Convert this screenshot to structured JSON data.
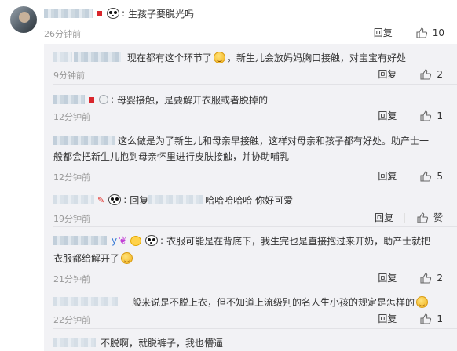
{
  "main_comment": {
    "text": "生孩子要脱光吗",
    "time": "26分钟前",
    "reply_label": "回复",
    "likes": "10"
  },
  "replies": [
    {
      "text_before_emoji": "现在都有这个环节了",
      "emoji": "laugh-cry-emoji",
      "text_after_emoji": "，新生儿会放妈妈胸口接触，对宝宝有好处",
      "time": "9分钟前",
      "reply_label": "回复",
      "likes": "2"
    },
    {
      "text": "母婴接触，是要解开衣服或者脱掉的",
      "time": "12分钟前",
      "reply_label": "回复",
      "likes": "1"
    },
    {
      "line1": "这么做是为了新生儿和母亲早接触，这样对母亲和孩子都有好处。助产士一",
      "line2": "般都会把新生儿抱到母亲怀里进行皮肤接触，并协助哺乳",
      "time": "12分钟前",
      "reply_label": "回复",
      "likes": "5"
    },
    {
      "prefix": "回复",
      "text": "哈哈哈哈哈 你好可爱",
      "time": "19分钟前",
      "reply_label": "回复",
      "likes": "赞"
    },
    {
      "name_suffix": "y",
      "line1": "衣服可能是在背底下，我生完也是直接抱过来开奶，助产士就把",
      "line2": "衣服都给解开了",
      "time": "21分钟前",
      "reply_label": "回复",
      "likes": "2"
    },
    {
      "text": "一般来说是不脱上衣，但不知道上流级别的名人生小孩的规定是怎样的",
      "time": "22分钟前",
      "reply_label": "回复",
      "likes": "1"
    },
    {
      "text": "不脱啊，就脱裤子，我也懵逼"
    }
  ],
  "colors": {
    "reply_background": "#f2f2f5",
    "muted_text": "#999999",
    "link_blue": "#3a7bd5",
    "vip_red": "#d9262c"
  }
}
